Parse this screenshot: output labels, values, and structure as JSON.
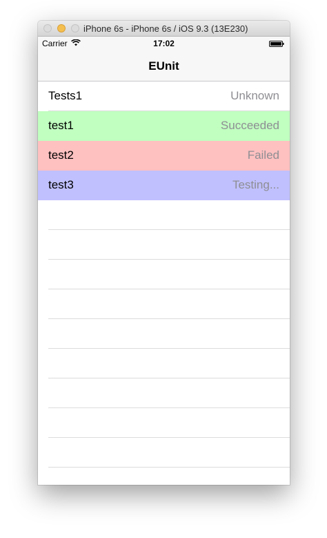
{
  "window": {
    "title": "iPhone 6s - iPhone 6s / iOS 9.3 (13E230)"
  },
  "status_bar": {
    "carrier": "Carrier",
    "time": "17:02",
    "wifi_icon": "wifi-icon",
    "battery_icon": "battery-icon"
  },
  "nav": {
    "title": "EUnit"
  },
  "rows": [
    {
      "name": "Tests1",
      "status": "Unknown",
      "color": "#ffffff"
    },
    {
      "name": "test1",
      "status": "Succeeded",
      "color": "#c0ffc0"
    },
    {
      "name": "test2",
      "status": "Failed",
      "color": "#ffc0c0"
    },
    {
      "name": "test3",
      "status": "Testing...",
      "color": "#c0c0ff"
    }
  ],
  "colors": {
    "succeeded": "#c0ffc0",
    "failed": "#ffc0c0",
    "testing": "#c0c0ff",
    "secondary_text": "#8e8e93"
  }
}
